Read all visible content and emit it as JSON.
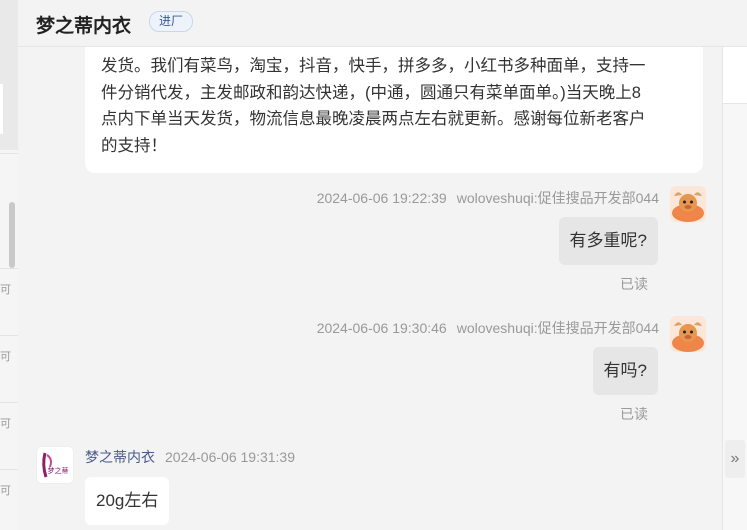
{
  "header": {
    "shop_name": "梦之蒂内衣",
    "enter_label": "进厂"
  },
  "messages": [
    {
      "lines": [
        "发货。我们有菜鸟，淘宝，抖音，快手，拼多多，小红书多种面单，支持一",
        "件分销代发，主发邮政和韵达快递，(中通，圆通只有菜单面单。)当天晚上8",
        "点内下单当天发货，物流信息最晚凌晨两点左右就更新。感谢每位新老客户",
        "的支持！"
      ]
    },
    {
      "time": "2024-06-06 19:22:39",
      "sender": "woloveshuqi:促佳搜品开发部044",
      "text": "有多重呢?",
      "status": "已读"
    },
    {
      "time": "2024-06-06 19:30:46",
      "sender": "woloveshuqi:促佳搜品开发部044",
      "text": "有吗?",
      "status": "已读"
    },
    {
      "sender": "梦之蒂内衣",
      "time": "2024-06-06 19:31:39",
      "text": "20g左右",
      "avatar_text": "梦之蒂"
    }
  ],
  "left_panel": {
    "labels": [
      "可",
      "可",
      "可",
      "可"
    ]
  },
  "right_panel": {
    "collapse_icon": "»"
  },
  "colors": {
    "accent_badge": "#3a5a98",
    "outgoing_bubble": "#e6e6e6",
    "incoming_bubble": "#ffffff",
    "avatar_orange": "#f0854a"
  }
}
